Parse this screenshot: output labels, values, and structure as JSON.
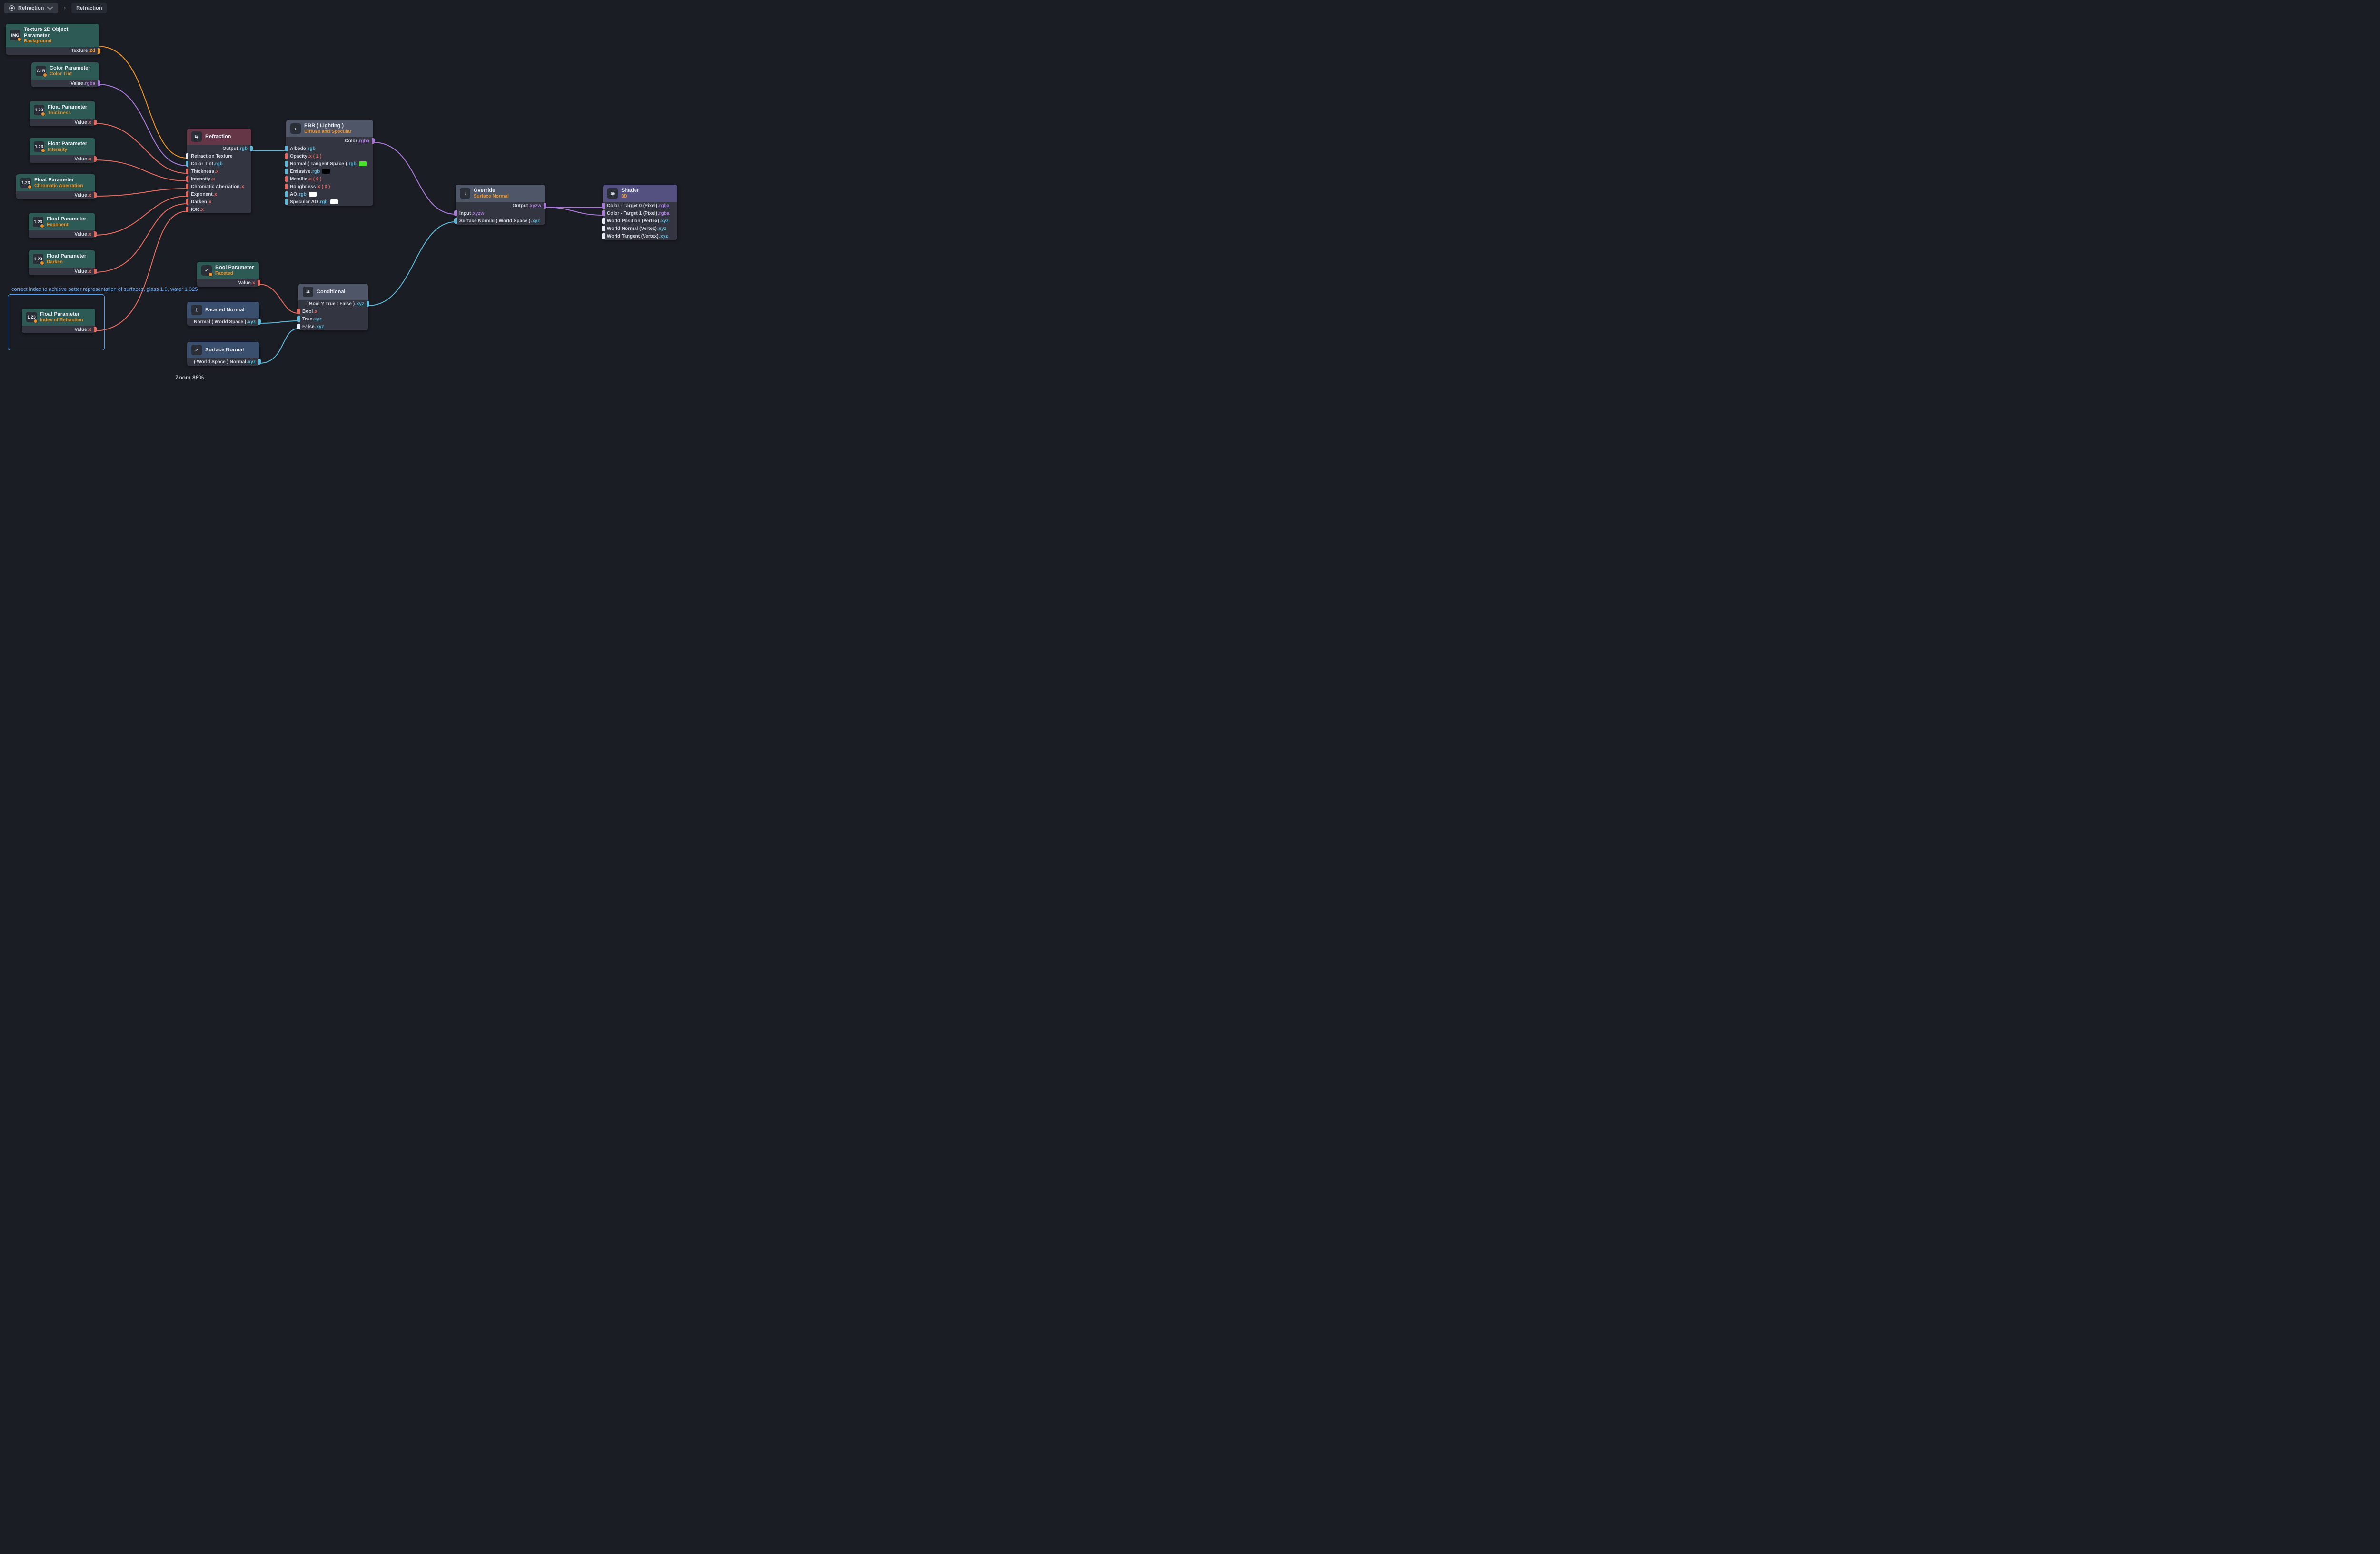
{
  "breadcrumb": {
    "root": "Refraction",
    "current": "Refraction"
  },
  "zoom": "Zoom 88%",
  "comment": "correct index to achieve better representation of surfaces, glass 1.5, water 1.325",
  "suffixes": {
    "d2": ".2d",
    "rgba": ".rgba",
    "rgb": ".rgb",
    "x": ".x",
    "xyz": ".xyz",
    "xyzw": ".xyzw"
  },
  "port_labels": {
    "value": "Value",
    "texture": "Texture",
    "output": "Output",
    "color": "Color",
    "input": "Input",
    "normalws": "Normal ( World Space )",
    "wsnormal": "( World Space ) Normal",
    "surfnormws": "Surface Normal ( World Space )",
    "condout": "( Bool ? True : False )"
  },
  "nodes": {
    "tex": {
      "title": "Texture 2D Object Parameter",
      "sub": "Background",
      "icon": "IMG"
    },
    "color": {
      "title": "Color Parameter",
      "sub": "Color Tint",
      "icon": "CLR"
    },
    "thick": {
      "title": "Float Parameter",
      "sub": "Thickness",
      "icon": "1.23"
    },
    "inten": {
      "title": "Float Parameter",
      "sub": "Intensity",
      "icon": "1.23"
    },
    "chrom": {
      "title": "Float Parameter",
      "sub": "Chromatic Aberration",
      "icon": "1.23"
    },
    "expo": {
      "title": "Float Parameter",
      "sub": "Exponent",
      "icon": "1.23"
    },
    "dark": {
      "title": "Float Parameter",
      "sub": "Darken",
      "icon": "1.23"
    },
    "ior": {
      "title": "Float Parameter",
      "sub": "Index of Refraction",
      "icon": "1.23"
    },
    "bool": {
      "title": "Bool Parameter",
      "sub": "Faceted",
      "icon": "✓"
    },
    "faceted": {
      "title": "Faceted Normal",
      "icon": "↥"
    },
    "surf": {
      "title": "Surface Normal",
      "icon": "↗"
    },
    "cond": {
      "title": "Conditional",
      "icon": "⇄"
    },
    "refr": {
      "title": "Refraction",
      "icon": "⇆",
      "inputs": [
        "Refraction Texture",
        "Color Tint",
        "Thickness",
        "Intensity",
        "Chromatic Aberration",
        "Exponent",
        "Darken",
        "IOR"
      ],
      "inputs_suf": [
        "",
        ".rgb",
        ".x",
        ".x",
        ".x",
        ".x",
        ".x",
        ".x"
      ]
    },
    "pbr": {
      "title": "PBR ( Lighting )",
      "sub": "Diffuse and Specular",
      "icon": "◐",
      "inputs": [
        "Albedo",
        "Opacity",
        "Normal ( Tangent Space )",
        "Emissive",
        "Metallic",
        "Roughness",
        "AO",
        "Specular AO"
      ],
      "inputs_suf": [
        ".rgb",
        ".x ( 1 )",
        ".rgb",
        ".rgb",
        ".x ( 0 )",
        ".x ( 0 )",
        ".rgb",
        ".rgb"
      ],
      "swatches": [
        "",
        "",
        "#49e02b",
        "#000000",
        "",
        "",
        "#ffffff",
        "#ffffff"
      ]
    },
    "over": {
      "title": "Override",
      "sub": "Surface Normal",
      "icon": "↓"
    },
    "shader": {
      "title": "Shader",
      "sub": "3D",
      "icon": "◉",
      "inputs": [
        "Color - Target 0 (Pixel)",
        "Color - Target 1 (Pixel)",
        "World Position (Vertex)",
        "World Normal (Vertex)",
        "World Tangent (Vertex)"
      ],
      "inputs_suf": [
        ".rgba",
        ".rgba",
        ".xyz",
        ".xyz",
        ".xyz"
      ]
    }
  },
  "cond_inputs": {
    "bool": "Bool",
    "true": "True",
    "false": "False"
  }
}
